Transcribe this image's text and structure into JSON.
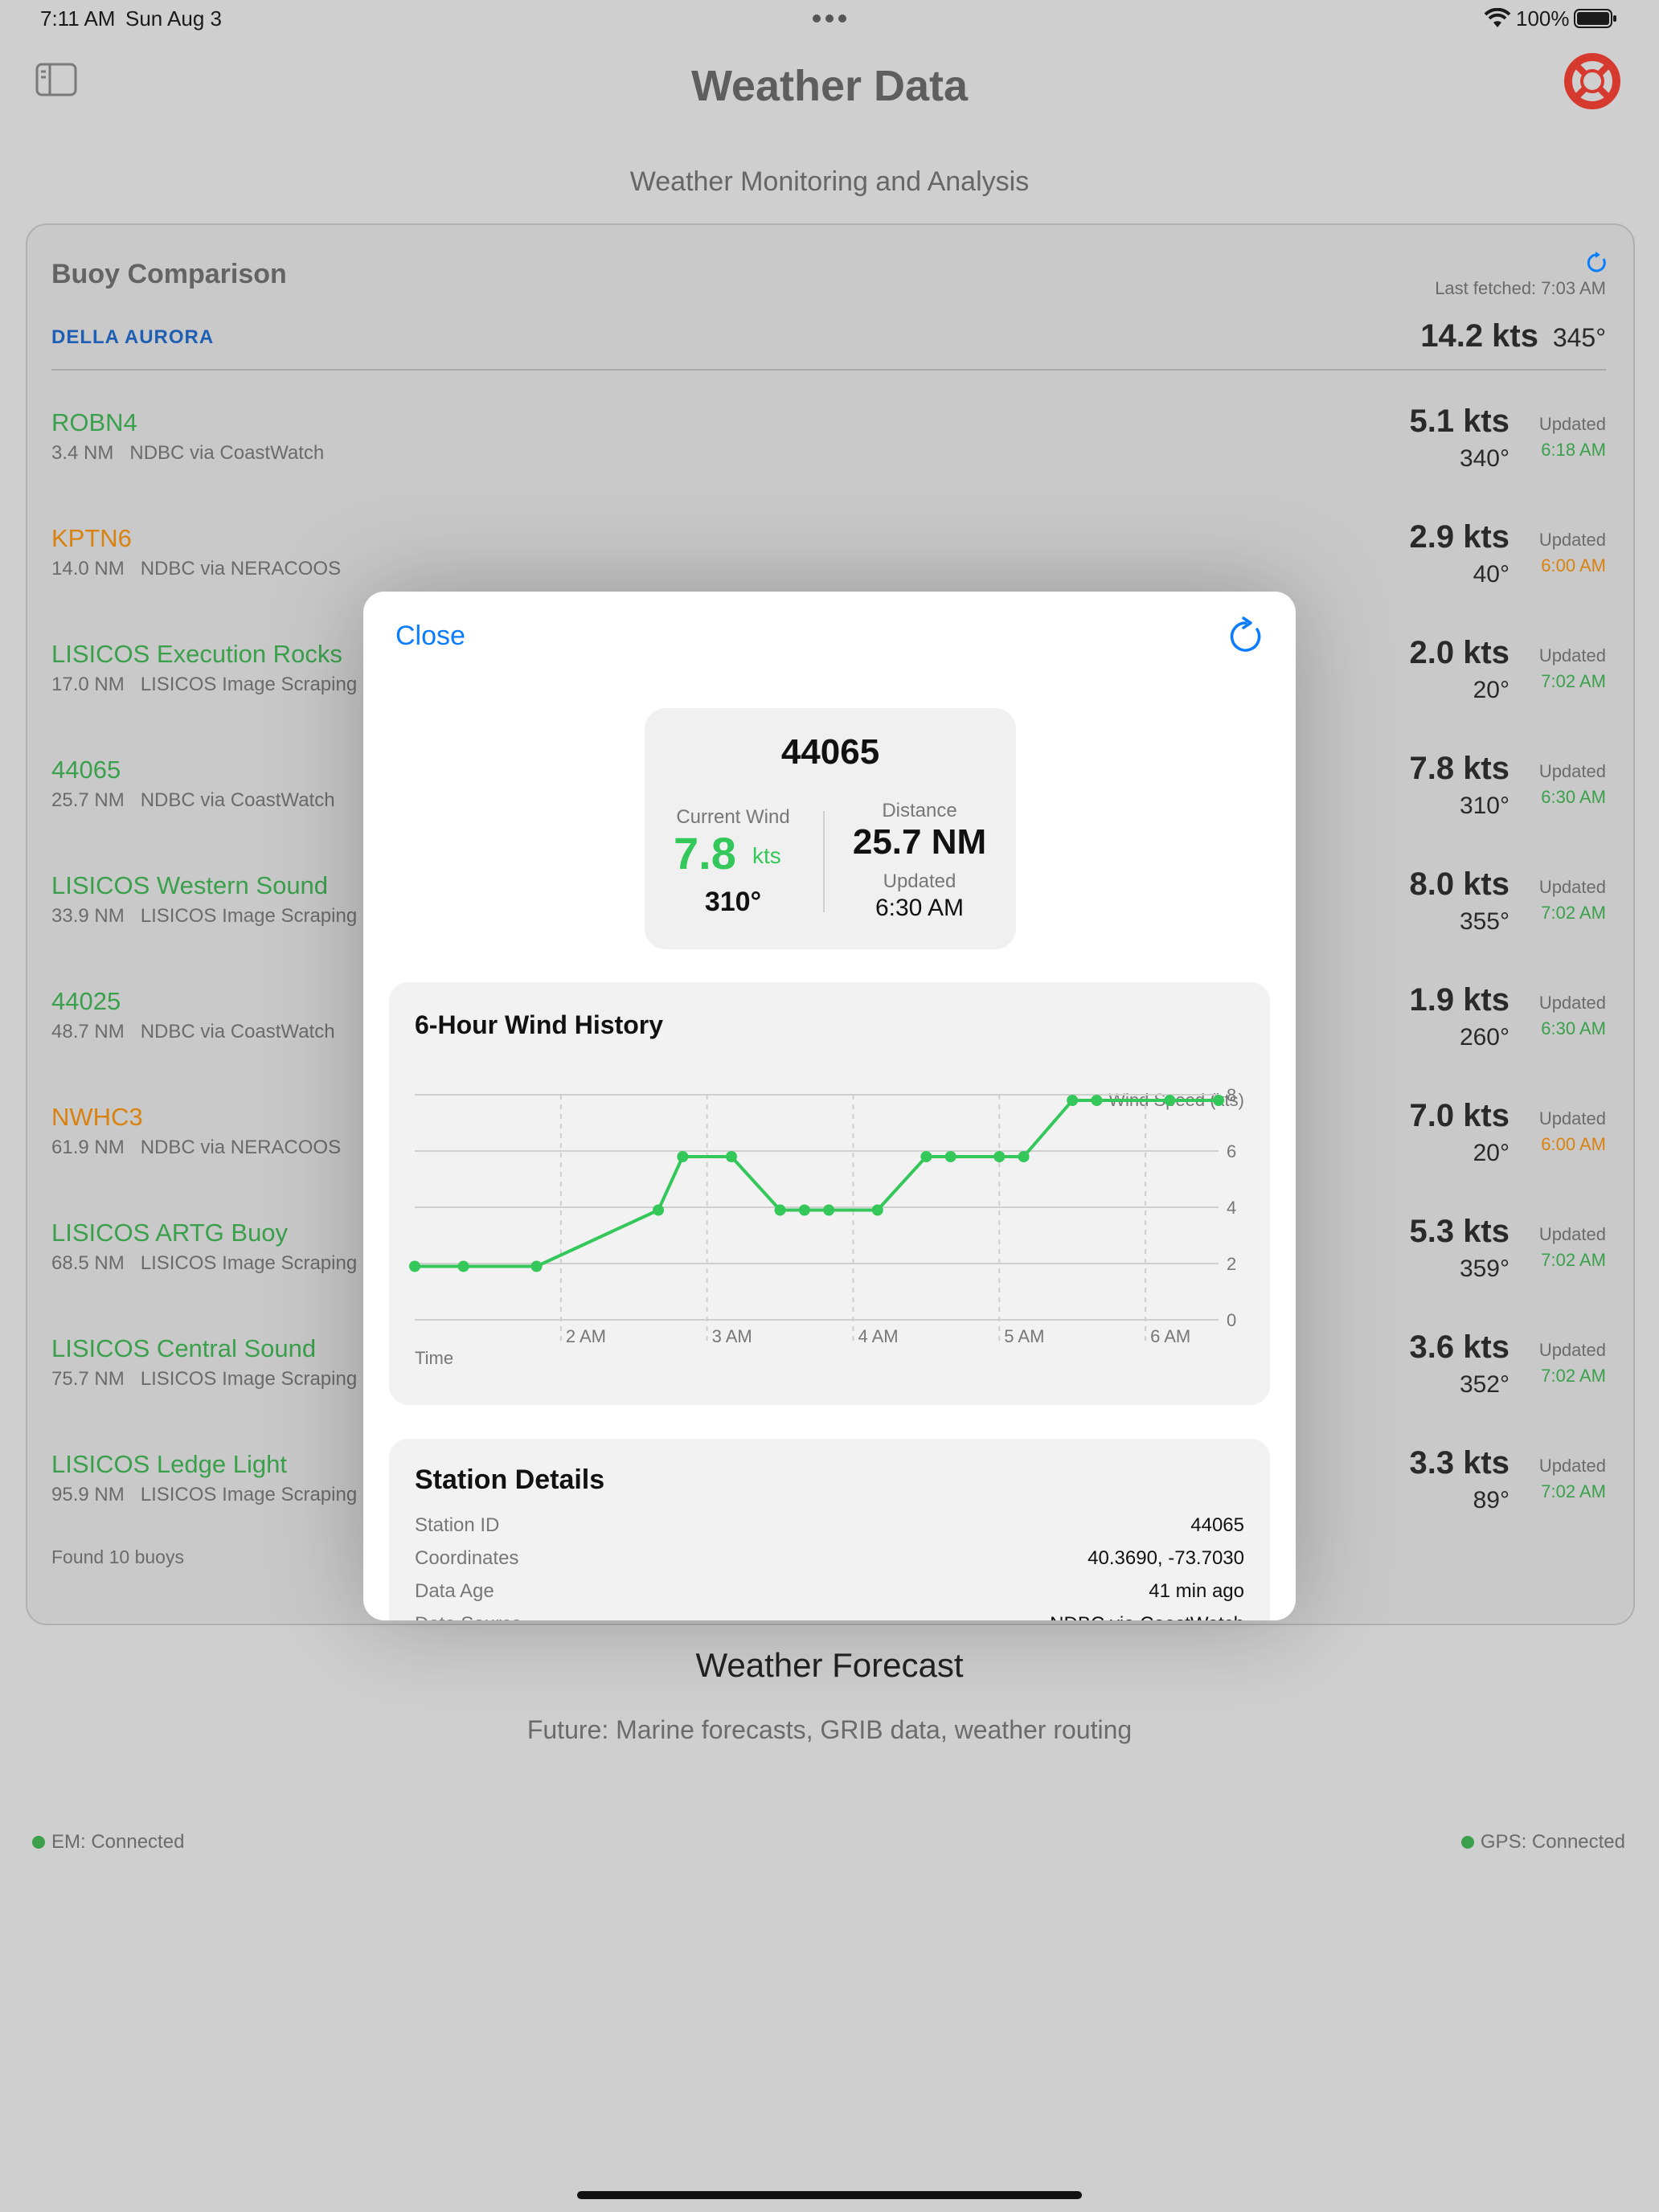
{
  "status_bar": {
    "time": "7:11 AM",
    "date": "Sun Aug 3",
    "battery": "100%"
  },
  "header": {
    "title": "Weather Data",
    "subtitle": "Weather Monitoring and Analysis"
  },
  "buoy_card": {
    "title": "Buoy Comparison",
    "last_fetched": "Last fetched: 7:03 AM",
    "own_vessel": {
      "name": "DELLA AURORA",
      "speed": "14.2 kts",
      "direction": "345°"
    },
    "updated_label": "Updated",
    "rows": [
      {
        "name": "ROBN4",
        "distance": "3.4 NM",
        "source": "NDBC via CoastWatch",
        "speed": "5.1 kts",
        "direction": "340°",
        "time": "6:18 AM",
        "status": "green"
      },
      {
        "name": "KPTN6",
        "distance": "14.0 NM",
        "source": "NDBC via NERACOOS",
        "speed": "2.9 kts",
        "direction": "40°",
        "time": "6:00 AM",
        "status": "orange"
      },
      {
        "name": "LISICOS Execution Rocks",
        "distance": "17.0 NM",
        "source": "LISICOS Image Scraping",
        "speed": "2.0 kts",
        "direction": "20°",
        "time": "7:02 AM",
        "status": "green"
      },
      {
        "name": "44065",
        "distance": "25.7 NM",
        "source": "NDBC via CoastWatch",
        "speed": "7.8 kts",
        "direction": "310°",
        "time": "6:30 AM",
        "status": "green"
      },
      {
        "name": "LISICOS Western Sound",
        "distance": "33.9 NM",
        "source": "LISICOS Image Scraping",
        "speed": "8.0 kts",
        "direction": "355°",
        "time": "7:02 AM",
        "status": "green"
      },
      {
        "name": "44025",
        "distance": "48.7 NM",
        "source": "NDBC via CoastWatch",
        "speed": "1.9 kts",
        "direction": "260°",
        "time": "6:30 AM",
        "status": "green"
      },
      {
        "name": "NWHC3",
        "distance": "61.9 NM",
        "source": "NDBC via NERACOOS",
        "speed": "7.0 kts",
        "direction": "20°",
        "time": "6:00 AM",
        "status": "orange"
      },
      {
        "name": "LISICOS ARTG Buoy",
        "distance": "68.5 NM",
        "source": "LISICOS Image Scraping",
        "speed": "5.3 kts",
        "direction": "359°",
        "time": "7:02 AM",
        "status": "green"
      },
      {
        "name": "LISICOS Central Sound",
        "distance": "75.7 NM",
        "source": "LISICOS Image Scraping",
        "speed": "3.6 kts",
        "direction": "352°",
        "time": "7:02 AM",
        "status": "green"
      },
      {
        "name": "LISICOS Ledge Light",
        "distance": "95.9 NM",
        "source": "LISICOS Image Scraping",
        "speed": "3.3 kts",
        "direction": "89°",
        "time": "7:02 AM",
        "status": "green"
      }
    ],
    "found": "Found 10 buoys"
  },
  "forecast": {
    "title": "Weather Forecast",
    "subtitle": "Future: Marine forecasts, GRIB data, weather routing"
  },
  "connections": {
    "em": "EM: Connected",
    "gps": "GPS: Connected"
  },
  "modal": {
    "close_label": "Close",
    "station_id": "44065",
    "current_wind_label": "Current Wind",
    "wind_speed": "7.8",
    "wind_unit": "kts",
    "wind_direction": "310°",
    "distance_label": "Distance",
    "distance": "25.7 NM",
    "updated_label": "Updated",
    "updated": "6:30 AM",
    "details": {
      "title": "Station Details",
      "rows": [
        {
          "key": "Station ID",
          "value": "44065"
        },
        {
          "key": "Coordinates",
          "value": "40.3690, -73.7030"
        },
        {
          "key": "Data Age",
          "value": "41 min ago"
        },
        {
          "key": "Data Source",
          "value": "NDBC via CoastWatch"
        }
      ]
    }
  },
  "colors": {
    "accent": "#0a7cff",
    "green": "#34c759",
    "orange": "#d9820f",
    "lifebuoy": "#d63a2f"
  },
  "chart_data": {
    "type": "line",
    "title": "6-Hour Wind History",
    "xlabel": "Time",
    "ylabel": "Wind Speed (kts)",
    "x_ticks": [
      "2 AM",
      "3 AM",
      "4 AM",
      "5 AM",
      "6 AM"
    ],
    "y_ticks": [
      0,
      2,
      4,
      6,
      8
    ],
    "ylim": [
      0,
      8
    ],
    "grid": true,
    "series": [
      {
        "color": "#34c759",
        "x": [
          "1:00",
          "1:20",
          "1:50",
          "2:40",
          "2:50",
          "3:10",
          "3:30",
          "3:40",
          "3:50",
          "4:10",
          "4:30",
          "4:40",
          "5:00",
          "5:10",
          "5:30",
          "5:40",
          "6:10",
          "6:30"
        ],
        "values": [
          1.9,
          1.9,
          1.9,
          3.9,
          5.8,
          5.8,
          3.9,
          3.9,
          3.9,
          3.9,
          5.8,
          5.8,
          5.8,
          5.8,
          7.8,
          7.8,
          7.8,
          7.8
        ]
      }
    ]
  }
}
